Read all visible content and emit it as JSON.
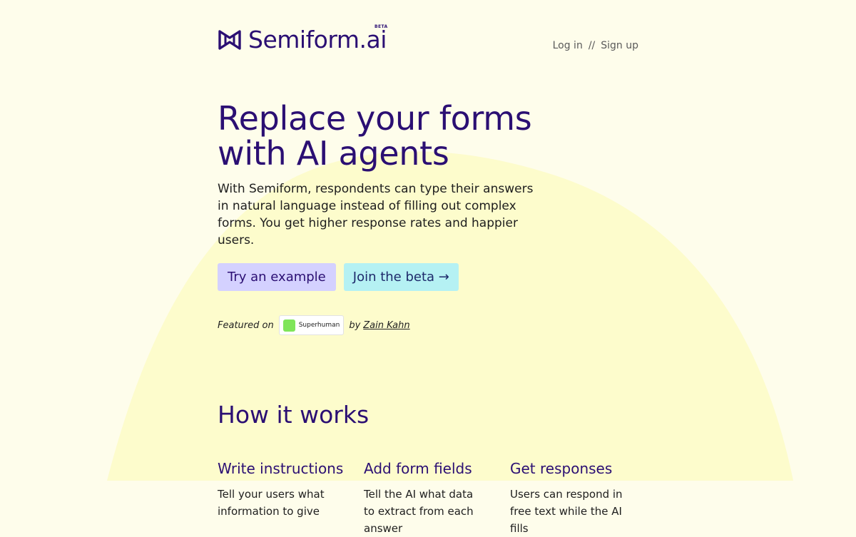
{
  "brand": {
    "name": "Semiform.ai",
    "badge": "BETA",
    "icon": "bowtie-logo-icon"
  },
  "nav": {
    "login": "Log in",
    "separator": "//",
    "signup": "Sign up"
  },
  "hero": {
    "title_line1": "Replace your forms",
    "title_line2": "with AI agents",
    "subtitle": "With Semiform, respondents can type their answers in natural language instead of filling out complex forms. You get higher response rates and happier users.",
    "primary_button": "Try an example",
    "secondary_button": "Join the beta →"
  },
  "featured": {
    "prefix": "Featured on",
    "badge_label": "Superhuman",
    "by": "by",
    "author": "Zain Kahn"
  },
  "how_it_works": {
    "title": "How it works",
    "steps": [
      {
        "title": "Write instructions",
        "text": "Tell your users what information to give"
      },
      {
        "title": "Add form fields",
        "text": "Tell the AI what data to extract from each answer"
      },
      {
        "title": "Get responses",
        "text": "Users can respond in free text while the AI fills"
      }
    ]
  },
  "colors": {
    "background": "#fefdeb",
    "blob": "#fdfccc",
    "brand": "#2b0f73",
    "button_primary": "#d4d1ff",
    "button_secondary": "#b5f1f3"
  }
}
